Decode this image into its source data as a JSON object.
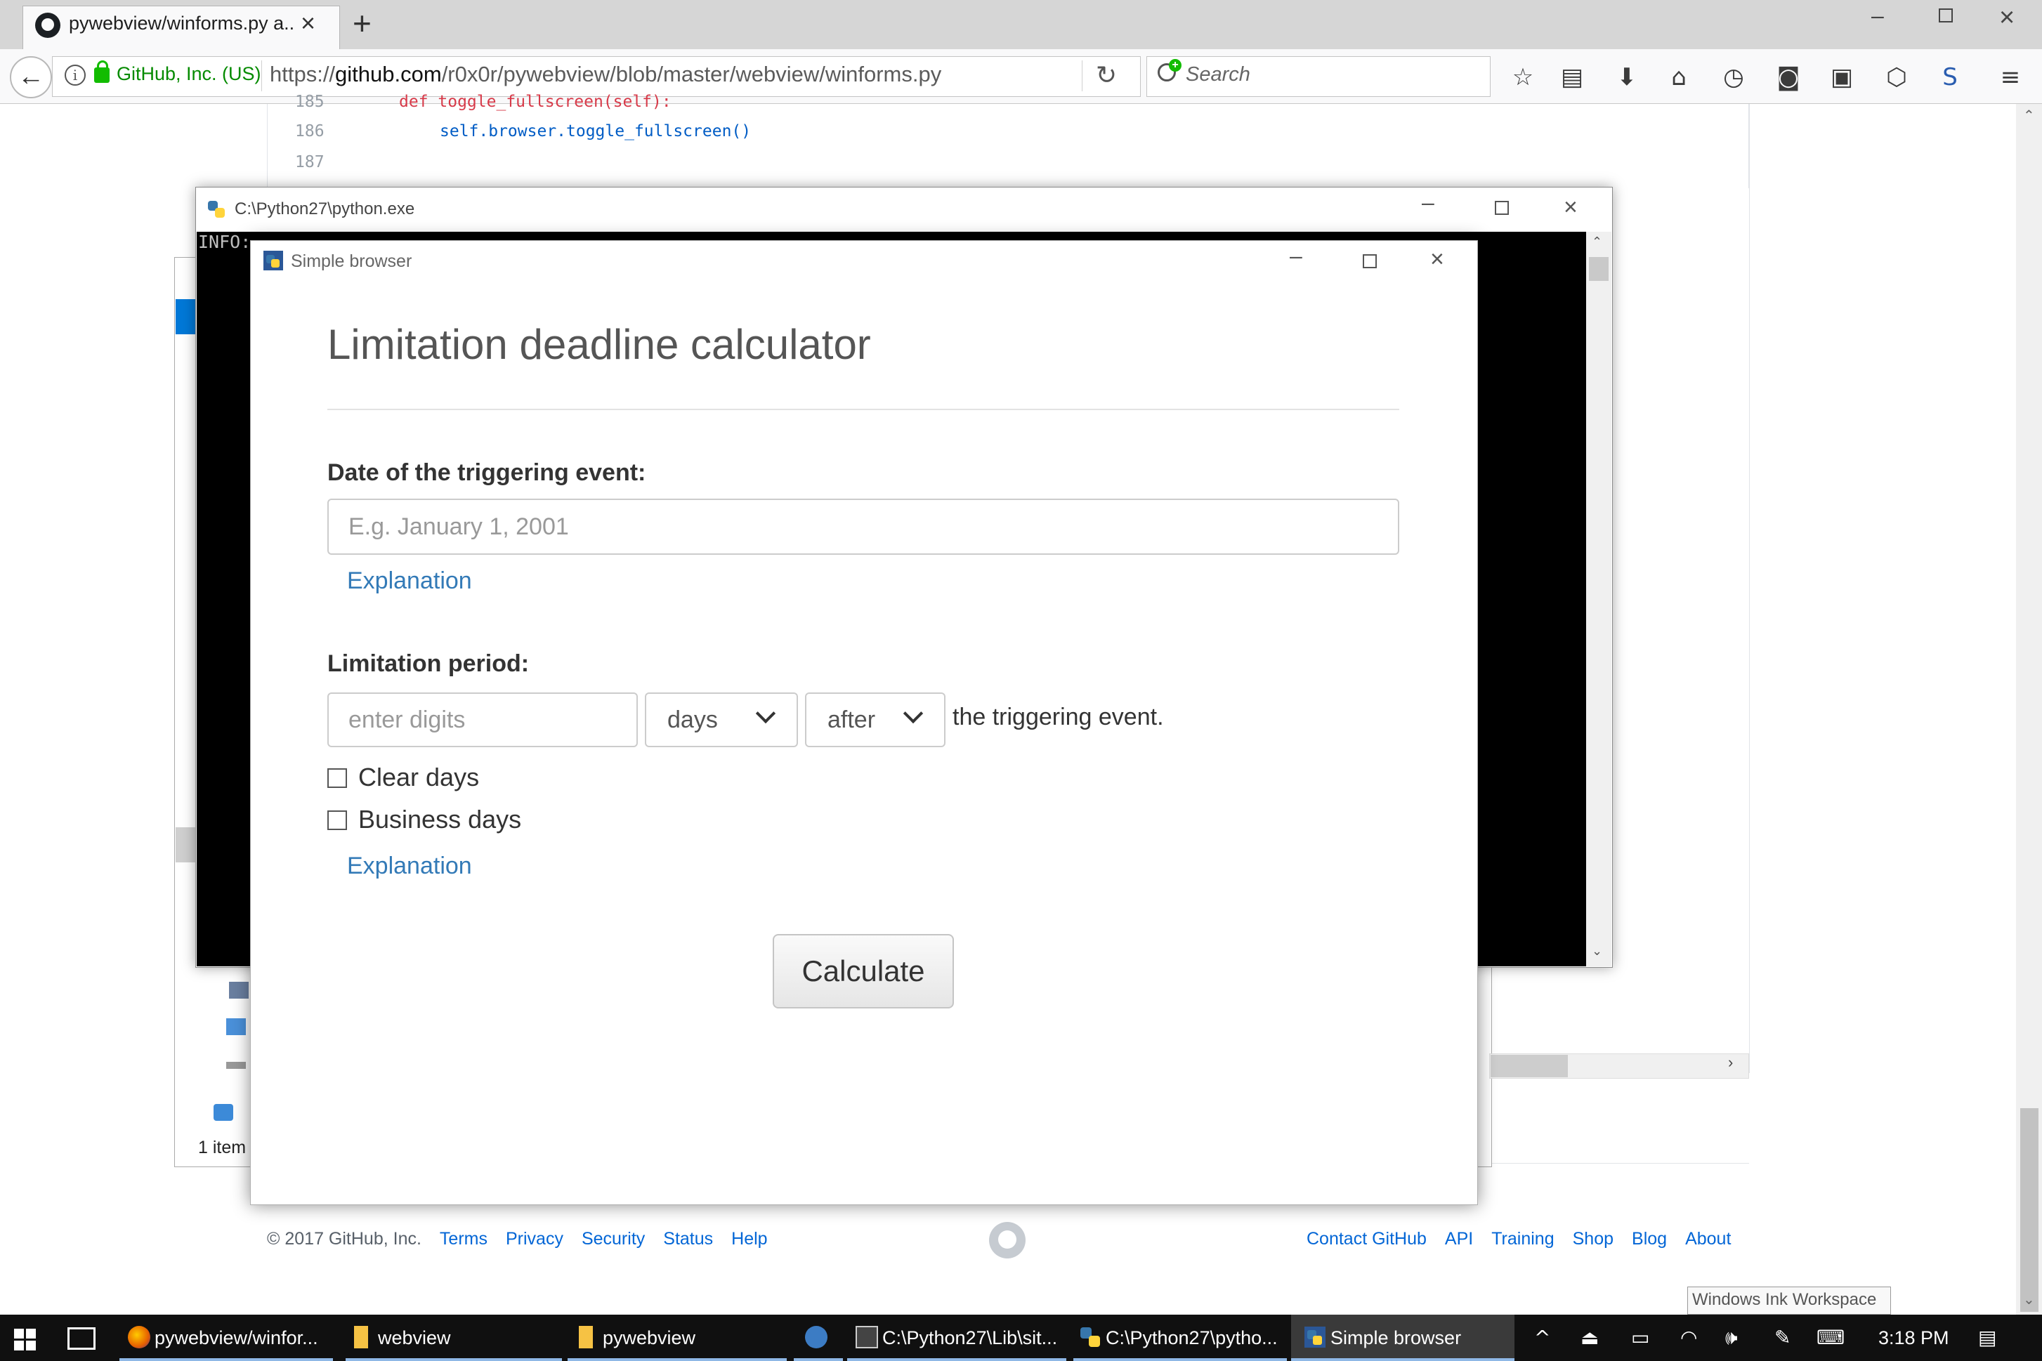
{
  "browser": {
    "tab_title": "pywebview/winforms.py a...",
    "site_identity": "GitHub, Inc. (US)",
    "url_prefix": "https://",
    "url_host": "github.com",
    "url_path": "/r0x0r/pywebview/blob/master/webview/winforms.py",
    "search_placeholder": "Search",
    "toolbar_icons": [
      "star-icon",
      "reading-list-icon",
      "download-icon",
      "home-icon",
      "history-icon",
      "pocket-icon",
      "extension-icon",
      "extension-hex-icon",
      "extension-s-icon",
      "menu-icon"
    ]
  },
  "code": {
    "lines": [
      {
        "number": "185",
        "code": "def toggle_fullscreen(self):"
      },
      {
        "number": "186",
        "code": "self.browser.toggle_fullscreen()"
      },
      {
        "number": "187",
        "code": ""
      }
    ]
  },
  "github_footer": {
    "copyright": "© 2017 GitHub, Inc.",
    "left_links": [
      "Terms",
      "Privacy",
      "Security",
      "Status",
      "Help"
    ],
    "right_links": [
      "Contact GitHub",
      "API",
      "Training",
      "Shop",
      "Blog",
      "About"
    ]
  },
  "explorer": {
    "status": "1 item"
  },
  "console": {
    "title": "C:\\Python27\\python.exe",
    "text": "INFO: ..."
  },
  "simple_browser": {
    "title": "Simple browser",
    "heading": "Limitation deadline calculator",
    "date_label": "Date of the triggering event:",
    "date_placeholder": "E.g. January 1, 2001",
    "explanation_label": "Explanation",
    "period_label": "Limitation period:",
    "digits_placeholder": "enter digits",
    "unit_selected": "days",
    "direction_selected": "after",
    "after_text": "the triggering event.",
    "clear_days_label": "Clear days",
    "clear_days_checked": false,
    "business_days_label": "Business days",
    "business_days_checked": false,
    "explanation_label_2": "Explanation",
    "calculate_label": "Calculate"
  },
  "ink_tooltip": "Windows Ink Workspace",
  "taskbar": {
    "items": [
      {
        "label": "pywebview/winfor...",
        "icon": "firefox-icon"
      },
      {
        "label": "webview",
        "icon": "folder-icon"
      },
      {
        "label": "pywebview",
        "icon": "folder-icon"
      },
      {
        "label": "",
        "icon": "app-icon"
      },
      {
        "label": "C:\\Python27\\Lib\\sit...",
        "icon": "console-icon"
      },
      {
        "label": "C:\\Python27\\pytho...",
        "icon": "python-icon"
      },
      {
        "label": "Simple browser",
        "icon": "python-window-icon"
      }
    ],
    "clock": "3:18 PM",
    "colors": {
      "accent": "#8fb8e6",
      "background": "#101010"
    }
  },
  "colors": {
    "link": "#337ab7",
    "github_link": "#0366d6",
    "secure_green": "#058b00"
  }
}
